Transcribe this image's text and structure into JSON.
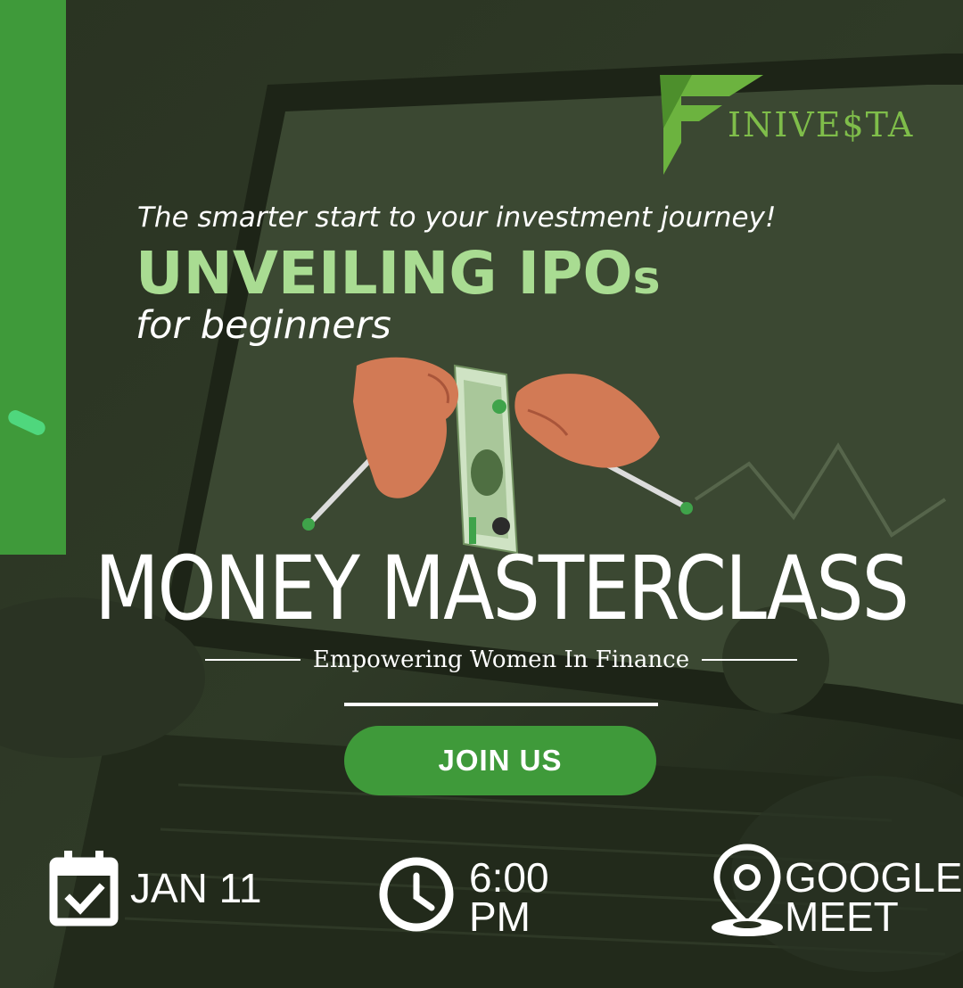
{
  "brand": {
    "logo_text": "INIVE$TA"
  },
  "tagline": "The smarter start to your investment journey!",
  "headline": {
    "main": "UNVEILING IPO",
    "suffix": "s"
  },
  "subhead": "for beginners",
  "event": {
    "title": "MONEY MASTERCLASS",
    "subtitle": "Empowering Women In Finance",
    "cta_label": "JOIN US"
  },
  "details": {
    "date": "JAN 11",
    "time_line1": "6:00",
    "time_line2": "PM",
    "venue_line1": "GOOGLE",
    "venue_line2": "MEET"
  },
  "icons": {
    "calendar": "calendar-check-icon",
    "clock": "clock-icon",
    "location": "location-pin-icon"
  },
  "colors": {
    "accent_green": "#3f9a3a",
    "headline_green": "#a9dc92",
    "background": "#27301f"
  }
}
